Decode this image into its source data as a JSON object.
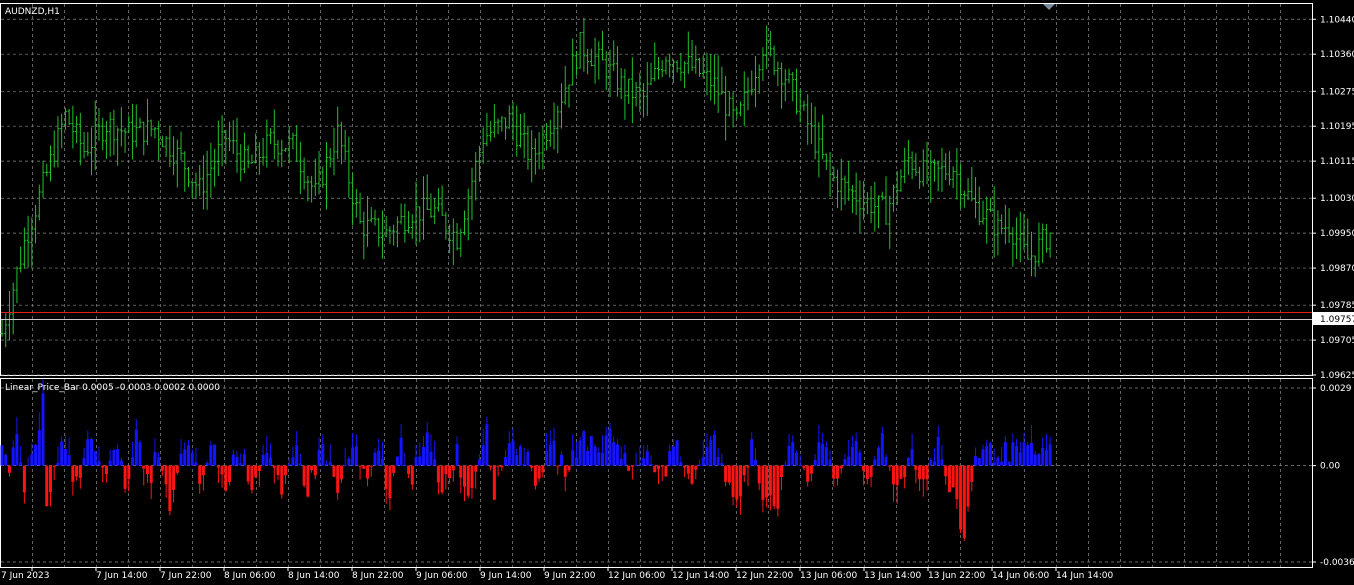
{
  "main_title": "AUDNZD,H1",
  "indicator_title": "Linear_Price_Bar 0.0005 -0.0003 0.0002 0.0000",
  "colors": {
    "background": "#000000",
    "grid": "#8a8a8a",
    "price_bars": "#22c02a",
    "bid_line": "#e21b1b",
    "ask_line": "#c8c8c8",
    "positive_bar": "#1414ff",
    "negative_bar": "#ff1414",
    "frame": "#ffffff"
  },
  "price_axis_labels": [
    "1.10440",
    "1.10360",
    "1.10275",
    "1.10195",
    "1.10115",
    "1.10030",
    "1.09950",
    "1.09870",
    "1.09785",
    "1.09705",
    "1.09625"
  ],
  "current_price": "1.09757",
  "indicator_axis_labels": [
    "0.0029",
    "0.00",
    "-0.0036"
  ],
  "time_labels": [
    "7 Jun 2023",
    "7 Jun 14:00",
    "7 Jun 22:00",
    "8 Jun 06:00",
    "8 Jun 14:00",
    "8 Jun 22:00",
    "9 Jun 06:00",
    "9 Jun 14:00",
    "9 Jun 22:00",
    "12 Jun 06:00",
    "12 Jun 14:00",
    "12 Jun 22:00",
    "13 Jun 06:00",
    "13 Jun 14:00",
    "13 Jun 22:00",
    "14 Jun 06:00",
    "14 Jun 14:00"
  ],
  "chart_data": {
    "type": "bar",
    "symbol": "AUDNZD",
    "timeframe": "H1",
    "price_ylim": [
      1.09625,
      1.10475
    ],
    "indicator_ylim": [
      -0.0036,
      0.0029
    ],
    "ohlc_keypoints": [
      [
        0,
        1.0972
      ],
      [
        6,
        1.0993
      ],
      [
        11,
        1.1006
      ],
      [
        17,
        1.1022
      ],
      [
        22,
        1.1014
      ],
      [
        28,
        1.102
      ],
      [
        34,
        1.1018
      ],
      [
        41,
        1.1019
      ],
      [
        48,
        1.1012
      ],
      [
        53,
        1.1005
      ],
      [
        60,
        1.1017
      ],
      [
        66,
        1.101
      ],
      [
        72,
        1.1016
      ],
      [
        78,
        1.1015
      ],
      [
        84,
        1.1004
      ],
      [
        90,
        1.1018
      ],
      [
        96,
        1.0997
      ],
      [
        103,
        1.0995
      ],
      [
        110,
        1.1
      ],
      [
        116,
        1.1
      ],
      [
        122,
        1.0994
      ],
      [
        129,
        1.1017
      ],
      [
        136,
        1.1021
      ],
      [
        142,
        1.1012
      ],
      [
        148,
        1.1022
      ],
      [
        155,
        1.1038
      ],
      [
        162,
        1.1033
      ],
      [
        167,
        1.1028
      ],
      [
        172,
        1.1026
      ],
      [
        178,
        1.1036
      ],
      [
        185,
        1.1033
      ],
      [
        191,
        1.1029
      ],
      [
        197,
        1.102
      ],
      [
        204,
        1.1038
      ],
      [
        210,
        1.1031
      ],
      [
        216,
        1.102
      ],
      [
        222,
        1.1008
      ],
      [
        230,
        1.1003
      ],
      [
        237,
        1.1
      ],
      [
        243,
        1.1012
      ],
      [
        248,
        1.1008
      ],
      [
        255,
        1.101
      ],
      [
        260,
        1.1002
      ],
      [
        264,
        1.0999
      ],
      [
        267,
        1.0996
      ],
      [
        270,
        1.0997
      ],
      [
        275,
        1.0989
      ],
      [
        281,
        1.0995
      ]
    ],
    "indicator_keypoints": [
      [
        0,
        0.0006
      ],
      [
        2,
        -0.0004
      ],
      [
        4,
        0.001
      ],
      [
        6,
        -0.0008
      ],
      [
        9,
        0.0005
      ],
      [
        11,
        0.0029
      ],
      [
        12,
        -0.0012
      ],
      [
        16,
        0.0007
      ],
      [
        20,
        -0.0006
      ],
      [
        24,
        0.0011
      ],
      [
        27,
        -0.0004
      ],
      [
        30,
        0.0009
      ],
      [
        33,
        -0.0007
      ],
      [
        36,
        0.0011
      ],
      [
        39,
        -0.0007
      ],
      [
        42,
        0.0006
      ],
      [
        45,
        -0.0018
      ],
      [
        49,
        0.0009
      ],
      [
        53,
        -0.0006
      ],
      [
        57,
        0.0008
      ],
      [
        60,
        -0.001
      ],
      [
        63,
        0.0007
      ],
      [
        67,
        -0.0006
      ],
      [
        71,
        0.0007
      ],
      [
        75,
        -0.0012
      ],
      [
        79,
        0.0006
      ],
      [
        82,
        -0.0009
      ],
      [
        86,
        0.0008
      ],
      [
        90,
        -0.001
      ],
      [
        94,
        0.0007
      ],
      [
        98,
        -0.0007
      ],
      [
        101,
        0.0006
      ],
      [
        104,
        -0.0011
      ],
      [
        107,
        0.0008
      ],
      [
        110,
        -0.0004
      ],
      [
        114,
        0.0009
      ],
      [
        118,
        -0.0008
      ],
      [
        122,
        0.0005
      ],
      [
        125,
        -0.0012
      ],
      [
        130,
        0.0016
      ],
      [
        132,
        -0.0009
      ],
      [
        136,
        0.001
      ],
      [
        140,
        0.0004
      ],
      [
        143,
        -0.0004
      ],
      [
        148,
        0.0006
      ],
      [
        152,
        -0.0003
      ],
      [
        155,
        0.0012
      ],
      [
        160,
        0.0005
      ],
      [
        163,
        0.0012
      ],
      [
        166,
        0.0006
      ],
      [
        169,
        -0.0003
      ],
      [
        173,
        0.0006
      ],
      [
        177,
        -0.0003
      ],
      [
        181,
        0.0006
      ],
      [
        184,
        -0.0006
      ],
      [
        188,
        0.0005
      ],
      [
        191,
        0.0013
      ],
      [
        194,
        -0.0007
      ],
      [
        198,
        -0.0014
      ],
      [
        201,
        0.001
      ],
      [
        204,
        -0.001
      ],
      [
        208,
        -0.0013
      ],
      [
        212,
        0.0009
      ],
      [
        216,
        -0.0005
      ],
      [
        220,
        0.0008
      ],
      [
        224,
        -0.0005
      ],
      [
        228,
        0.001
      ],
      [
        232,
        -0.0008
      ],
      [
        236,
        0.0011
      ],
      [
        240,
        -0.0009
      ],
      [
        244,
        0.0006
      ],
      [
        247,
        -0.0006
      ],
      [
        251,
        0.0008
      ],
      [
        254,
        -0.0009
      ],
      [
        256,
        -0.0015
      ],
      [
        258,
        -0.0027
      ],
      [
        261,
        0.0005
      ]
    ]
  }
}
